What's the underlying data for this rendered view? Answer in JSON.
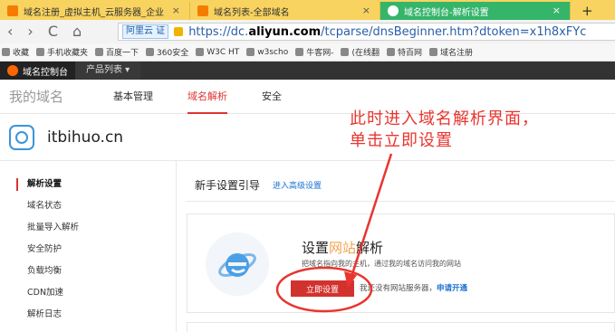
{
  "browser": {
    "tabs": [
      {
        "title": "域名注册_虚拟主机_云服务器_企业",
        "close": "×"
      },
      {
        "title": "域名列表-全部域名",
        "close": "×"
      },
      {
        "title": "域名控制台-解析设置",
        "close": "×"
      }
    ],
    "new_tab": "+",
    "nav": {
      "back": "‹",
      "forward": "›",
      "reload": "C",
      "home": "⌂"
    },
    "site_badge": "阿里云 证",
    "url_prefix": "https://dc.",
    "url_domain": "aliyun.com",
    "url_rest": "/tcparse/dnsBeginner.htm?dtoken=x1h8xFYc"
  },
  "bookmarks": [
    "收藏",
    "手机收藏夹",
    "百度一下",
    "360安全",
    "W3C HT",
    "w3scho",
    "牛客网-",
    "(在线翻",
    "特百网",
    "域名注册"
  ],
  "topbar": {
    "brand": "域名控制台",
    "products": "产品列表 ▾"
  },
  "subnav": {
    "title": "我的域名",
    "items": [
      "基本管理",
      "域名解析",
      "安全"
    ],
    "active_index": 1
  },
  "domain": {
    "name": "itbihuo.cn"
  },
  "sidebar": {
    "items": [
      "解析设置",
      "域名状态",
      "批量导入解析",
      "安全防护",
      "负载均衡",
      "CDN加速",
      "解析日志"
    ],
    "active_index": 0
  },
  "main": {
    "title": "新手设置引导",
    "advanced_link": "进入高级设置",
    "card": {
      "title_a": "设置",
      "title_hl": "网站",
      "title_b": "解析",
      "desc": "把域名指向我的主机，通过我的域名访问我的网站",
      "button": "立即设置",
      "no_server": "我还没有网站服务器，",
      "apply_link": "申请开通"
    }
  },
  "annotation": {
    "line1": "此时进入域名解析界面，",
    "line2": "单击立即设置"
  },
  "colors": {
    "accent": "#d2322d",
    "annotation": "#e8352e",
    "tab_active": "#35b56a",
    "tabbar": "#f8d35f"
  }
}
